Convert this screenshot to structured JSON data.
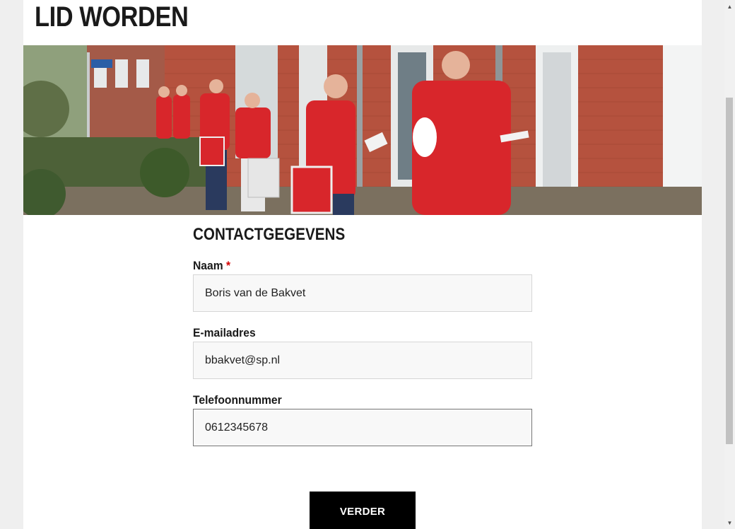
{
  "page": {
    "title": "LID WORDEN"
  },
  "hero": {
    "image": "canvassers-in-red-jackets-photo"
  },
  "form": {
    "section_title": "CONTACTGEGEVENS",
    "fields": [
      {
        "label": "Naam",
        "required_mark": "*",
        "value": "Boris van de Bakvet"
      },
      {
        "label": "E-mailadres",
        "value": "bbakvet@sp.nl"
      },
      {
        "label": "Telefoonnummer",
        "value": "0612345678",
        "focused": true
      }
    ],
    "submit_label": "VERDER"
  },
  "colors": {
    "background": "#efefef",
    "content": "#ffffff",
    "required": "#d40000",
    "brand_red": "#d8262b",
    "button": "#000000"
  },
  "scrollbar": {
    "up_icon": "arrow-up-icon",
    "down_icon": "arrow-down-icon"
  }
}
